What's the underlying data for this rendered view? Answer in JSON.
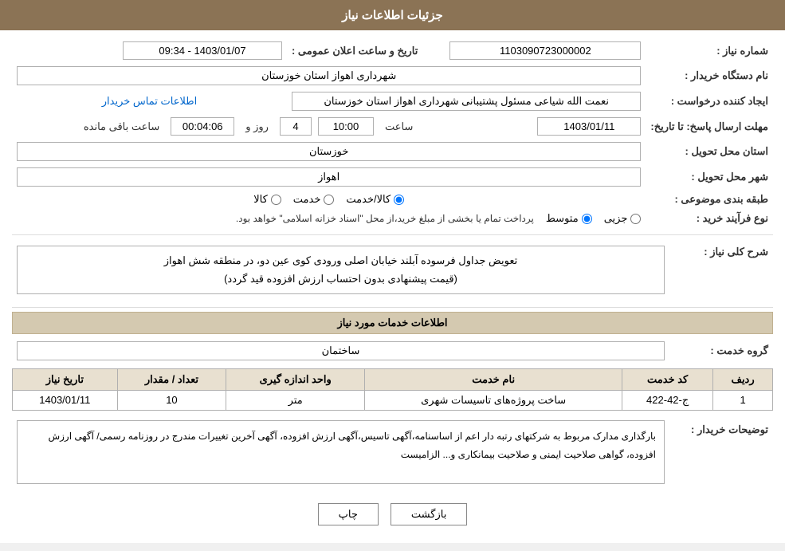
{
  "header": {
    "title": "جزئیات اطلاعات نیاز"
  },
  "fields": {
    "shomara_niaz_label": "شماره نیاز :",
    "shomara_niaz_value": "1103090723000002",
    "naam_dastgah_label": "نام دستگاه خریدار :",
    "naam_dastgah_value": "شهرداری اهواز استان خوزستان",
    "ejad_konande_label": "ایجاد کننده درخواست :",
    "ejad_konande_value": "نعمت الله شیاعی مسئول پشتیبانی شهرداری اهواز استان خوزستان",
    "ettelaat_tamas_label": "اطلاعات تماس خریدار",
    "mohlat_ersal_label": "مهلت ارسال پاسخ: تا تاریخ:",
    "tarikh_value": "1403/01/11",
    "saat_label": "ساعت",
    "saat_value": "10:00",
    "rooz_label": "روز و",
    "rooz_value": "4",
    "saat_mande_label": "ساعت باقی مانده",
    "saat_mande_value": "00:04:06",
    "ostan_label": "استان محل تحویل :",
    "ostan_value": "خوزستان",
    "shahr_label": "شهر محل تحویل :",
    "shahr_value": "اهواز",
    "tabaqe_label": "طبقه بندی موضوعی :",
    "radio_options": [
      "کالا",
      "خدمت",
      "کالا/خدمت"
    ],
    "radio_selected": "کالا/خدمت",
    "nooe_farayand_label": "نوع فرآیند خرید :",
    "radio_farayand": [
      "جزیی",
      "متوسط"
    ],
    "radio_farayand_selected": "متوسط",
    "farayand_note": "پرداخت تمام یا بخشی از مبلغ خرید،از محل \"اسناد خزانه اسلامی\" خواهد بود.",
    "sharh_section": "شرح کلی نیاز :",
    "sharh_value": "تعویض جداول فرسوده آبلند خیابان اصلی  ورودی کوی عین دو،  در منطقه شش اهواز\n(قیمت پیشنهادی بدون احتساب ارزش افزوده قید گردد)",
    "services_section_title": "اطلاعات خدمات مورد نیاز",
    "grooh_khadamat_label": "گروه خدمت :",
    "grooh_khadamat_value": "ساختمان",
    "services_table_headers": [
      "ردیف",
      "کد خدمت",
      "نام خدمت",
      "واحد اندازه گیری",
      "تعداد / مقدار",
      "تاریخ نیاز"
    ],
    "services_rows": [
      {
        "radif": "1",
        "kod": "ج-42-422",
        "naam": "ساخت پروژه‌های تاسیسات شهری",
        "vahed": "متر",
        "tedad": "10",
        "tarikh": "1403/01/11"
      }
    ],
    "buyer_notes_label": "توضیحات خریدار :",
    "buyer_notes_value": "بارگذاری مدارک مربوط به شرکتهای رتبه دار اعم از اساسنامه،آگهی تاسیس،آگهی ارزش افزوده، آگهی آخرین تغییرات مندرج در روزنامه رسمی/  آگهی ارزش افزوده، گواهی صلاحیت ایمنی و صلاحیت بیمانکاری و... الزامیست"
  },
  "buttons": {
    "print_label": "چاپ",
    "back_label": "بازگشت"
  }
}
